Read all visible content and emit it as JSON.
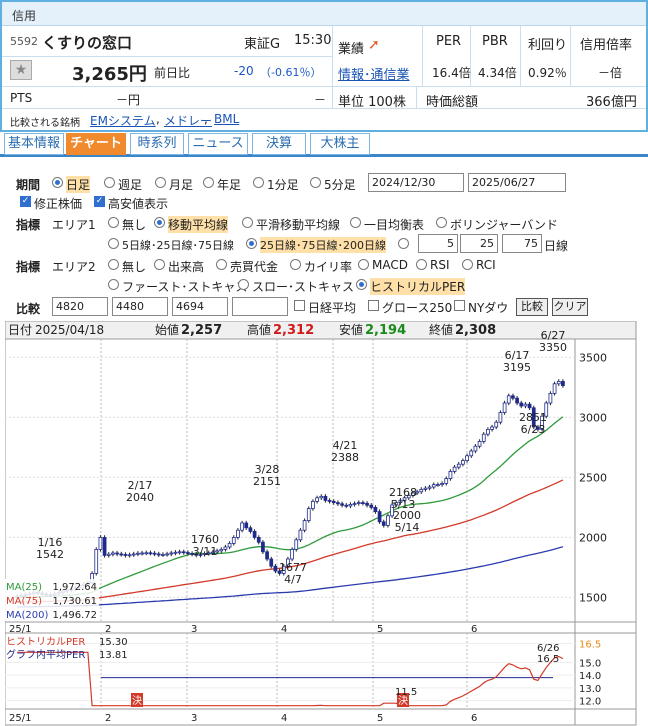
{
  "header": {
    "section": "信用",
    "code": "5592",
    "name": "くすりの窓口",
    "market": "東証G",
    "time": "15:30",
    "price": "3,265円",
    "change_label": "前日比",
    "change": "-20",
    "change_pct": "（-0.61％）",
    "gyoseki": "業績",
    "industry": "情報･通信業",
    "per_label": "PER",
    "pbr_label": "PBR",
    "yield_label": "利回り",
    "margin_label": "信用倍率",
    "per": "16.4倍",
    "pbr": "4.34倍",
    "yield": "0.92％",
    "margin": "－倍",
    "pts_label": "PTS",
    "pts": "－円",
    "pts_dash": "－",
    "unit": "単位 100株",
    "mcap_label": "時価総額",
    "mcap": "366億円",
    "compare_label": "比較される銘柄",
    "compare": [
      "EMシステム",
      "メドレー",
      "BML"
    ]
  },
  "tabs": [
    "基本情報",
    "チャート",
    "時系列",
    "ニュース",
    "決算",
    "大株主"
  ],
  "controls": {
    "period_label": "期間",
    "periods": [
      "日足",
      "週足",
      "月足",
      "年足",
      "1分足",
      "5分足"
    ],
    "date_from": "2024/12/30",
    "date_to": "2025/06/27",
    "adj_price": "修正株価",
    "high_low": "高安値表示",
    "indicator_label": "指標",
    "area1": "エリア1",
    "area1_opts": [
      "無し",
      "移動平均線",
      "平滑移動平均線",
      "一目均衡表",
      "ボリンジャーバンド"
    ],
    "ma_opt1": "5日線･25日線･75日線",
    "ma_opt2": "25日線･75日線･200日線",
    "ma_in": [
      "5",
      "25",
      "75"
    ],
    "ma_suffix": "日線",
    "area2": "エリア2",
    "area2_opts": [
      "無し",
      "出来高",
      "売買代金",
      "カイリ率",
      "MACD",
      "RSI",
      "RCI"
    ],
    "area2_opts2": [
      "ファースト･ストキャス",
      "スロー･ストキャス",
      "ヒストリカルPER"
    ],
    "compare_label": "比較",
    "compare_inputs": [
      "4820",
      "4480",
      "4694",
      ""
    ],
    "nikkei": "日経平均",
    "growth": "グロース250",
    "nydow": "NYダウ",
    "compare_btn": "比較",
    "clear_btn": "クリア"
  },
  "ohlc_bar": {
    "date_label": "日付",
    "date": "2025/04/18",
    "open_label": "始値",
    "open": "2,257",
    "high_label": "高値",
    "high": "2,312",
    "low_label": "安値",
    "low": "2,194",
    "close_label": "終値",
    "close": "2,308"
  },
  "chart_data": {
    "type": "candlestick",
    "x_ticks": [
      "25/1",
      "2",
      "3",
      "4",
      "5",
      "6"
    ],
    "y_ticks": [
      1500,
      2000,
      2500,
      3000,
      3500
    ],
    "ylim": [
      1320,
      3620
    ],
    "closes": [
      1510,
      1518,
      1525,
      1530,
      1542,
      1535,
      1528,
      1522,
      1518,
      1530,
      1540,
      1552,
      1560,
      1570,
      1580,
      1598,
      1610,
      1622,
      1700,
      1900,
      2000,
      1850,
      1860,
      1870,
      1862,
      1858,
      1850,
      1855,
      1862,
      1868,
      1870,
      1872,
      1868,
      1862,
      1855,
      1858,
      1862,
      1870,
      1876,
      1880,
      1874,
      1866,
      1860,
      1852,
      1858,
      1866,
      1872,
      1878,
      1888,
      1900,
      1920,
      1950,
      2000,
      2060,
      2120,
      2080,
      2050,
      2000,
      1960,
      1880,
      1820,
      1760,
      1720,
      1700,
      1760,
      1820,
      1900,
      1980,
      2060,
      2140,
      2240,
      2300,
      2330,
      2342,
      2308,
      2300,
      2290,
      2280,
      2268,
      2262,
      2275,
      2282,
      2290,
      2284,
      2268,
      2250,
      2215,
      2130,
      2100,
      2180,
      2270,
      2290,
      2310,
      2330,
      2350,
      2370,
      2380,
      2400,
      2410,
      2420,
      2440,
      2440,
      2450,
      2490,
      2550,
      2585,
      2610,
      2640,
      2680,
      2720,
      2760,
      2800,
      2860,
      2900,
      2920,
      2960,
      3040,
      3120,
      3180,
      3160,
      3120,
      3095,
      3110,
      3080,
      2920,
      2900,
      3010,
      3120,
      3200,
      3280,
      3300,
      3265
    ],
    "annotations": [
      [
        "1/16",
        "1542"
      ],
      [
        "2/17",
        "2040"
      ],
      [
        "1760",
        "3/11"
      ],
      [
        "3/28",
        "2151"
      ],
      [
        "1677",
        "4/7"
      ],
      [
        "4/21",
        "2388"
      ],
      [
        "2168",
        "5/13"
      ],
      [
        "2000",
        "5/14"
      ],
      [
        "6/17",
        "3195"
      ],
      [
        "6/27",
        "3350"
      ],
      [
        "2851",
        "6/23"
      ]
    ],
    "ma25": "1,972.64",
    "ma75": "1,730.61",
    "ma200": "1,496.72",
    "ma_labels": [
      "MA(25)",
      "MA(75)",
      "MA(200)"
    ],
    "per_legend": [
      "ヒストリカルPER",
      "グラフ内平均PER"
    ],
    "per_now": "15.30",
    "per_avg": "13.81",
    "per_ticks": [
      12.0,
      13.0,
      14.0,
      15.0,
      16.5
    ],
    "per_ann": [
      "6/26",
      "16.5"
    ],
    "per_low": "11.5",
    "kessan": "決",
    "colors": {
      "up": "#1f2b8c",
      "down": "#1a1a1a",
      "ma25": "#2f9a3a",
      "ma75": "#d23a2a",
      "ma200": "#2c3cb0",
      "per": "#d23a2a",
      "per_avg": "#1f2b8c"
    }
  }
}
